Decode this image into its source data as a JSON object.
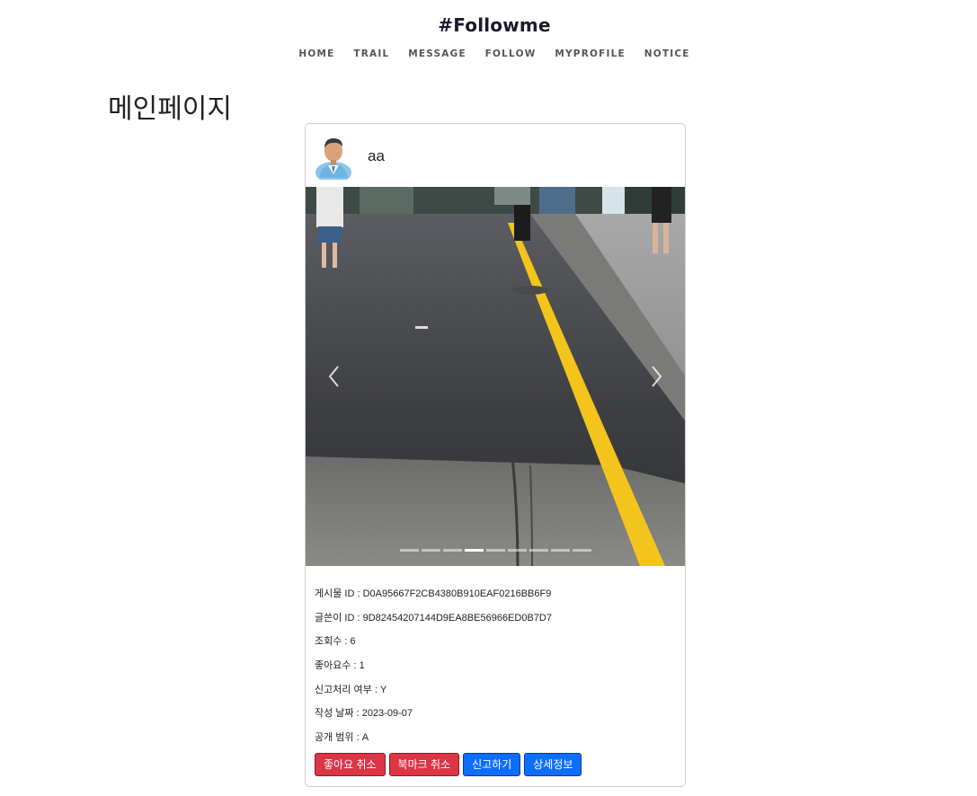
{
  "site": {
    "title": "#Followme"
  },
  "nav": {
    "items": [
      "HOME",
      "TRAIL",
      "MESSAGE",
      "FOLLOW",
      "MYPROFILE",
      "NOTICE"
    ]
  },
  "page": {
    "heading": "메인페이지"
  },
  "post": {
    "username": "aa",
    "carousel": {
      "slide_count": 9,
      "active_index": 3,
      "prev_icon": "chevron-left-icon",
      "next_icon": "chevron-right-icon"
    },
    "fields": [
      "게시물 ID : D0A95667F2CB4380B910EAF0216BB6F9",
      "글쓴이 ID : 9D82454207144D9EA8BE56966ED0B7D7",
      "조회수 : 6",
      "좋아요수 : 1",
      "신고처리 여부 : Y",
      "작성 날짜 : 2023-09-07",
      "공개 범위 : A"
    ],
    "buttons": {
      "unlike": "좋아요 취소",
      "unbookmark": "북마크 취소",
      "report": "신고하기",
      "detail": "상세정보"
    }
  },
  "colors": {
    "danger": "#dc3545",
    "primary": "#0d6efd",
    "road_line": "#f2c41c"
  }
}
